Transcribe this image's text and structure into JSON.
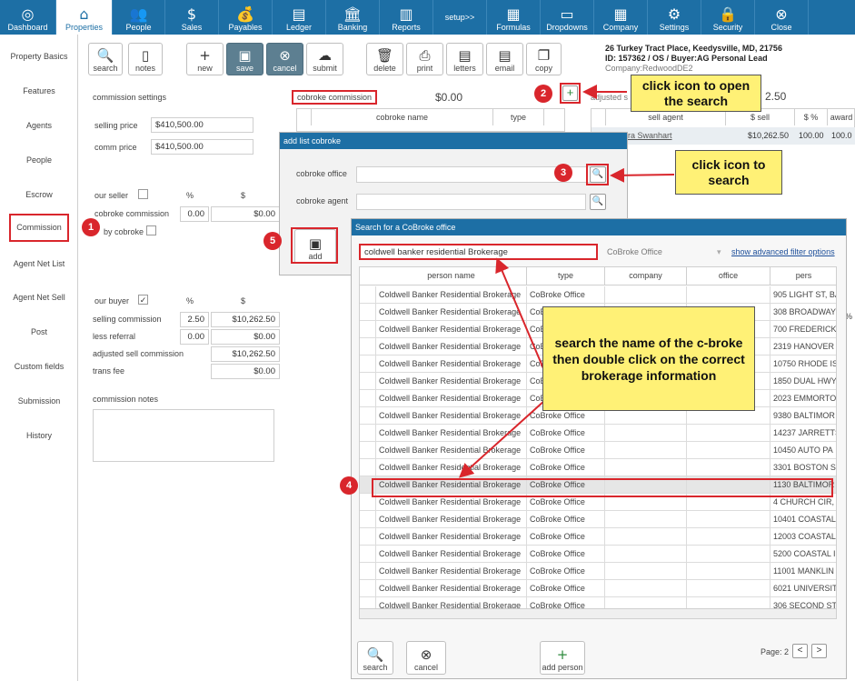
{
  "nav": {
    "items": [
      {
        "key": "dashboard",
        "label": "Dashboard",
        "icon": "◎"
      },
      {
        "key": "properties",
        "label": "Properties",
        "icon": "⌂"
      },
      {
        "key": "people",
        "label": "People",
        "icon": "👥"
      },
      {
        "key": "sales",
        "label": "Sales",
        "icon": "$"
      },
      {
        "key": "payables",
        "label": "Payables",
        "icon": "💰"
      },
      {
        "key": "ledger",
        "label": "Ledger",
        "icon": "▤"
      },
      {
        "key": "banking",
        "label": "Banking",
        "icon": "🏛"
      },
      {
        "key": "reports",
        "label": "Reports",
        "icon": "▥"
      },
      {
        "key": "setup",
        "label": "setup>>",
        "icon": ""
      },
      {
        "key": "formulas",
        "label": "Formulas",
        "icon": "▦"
      },
      {
        "key": "dropdowns",
        "label": "Dropdowns",
        "icon": "▭"
      },
      {
        "key": "company",
        "label": "Company",
        "icon": "▦"
      },
      {
        "key": "settings",
        "label": "Settings",
        "icon": "⚙"
      },
      {
        "key": "security",
        "label": "Security",
        "icon": "🔒"
      },
      {
        "key": "close",
        "label": "Close",
        "icon": "⊗"
      }
    ]
  },
  "sidebar": {
    "items": [
      "Property Basics",
      "Features",
      "Agents",
      "People",
      "Escrow",
      "Commission",
      "Agent Net List",
      "Agent Net Sell",
      "Post",
      "Custom fields",
      "Submission",
      "History"
    ]
  },
  "toolbar": {
    "search": "search",
    "notes": "notes",
    "new": "new",
    "save": "save",
    "cancel": "cancel",
    "submit": "submit",
    "delete": "delete",
    "print": "print",
    "letters": "letters",
    "email": "email",
    "copy": "copy"
  },
  "property": {
    "address": "26 Turkey Tract Place, Keedysville, MD, 21756",
    "id_line": "ID: 157362 / OS / Buyer:AG Personal Lead",
    "company": "Company:RedwoodDE2"
  },
  "commission": {
    "settings_label": "commission settings",
    "selling_price_label": "selling price",
    "selling_price": "$410,500.00",
    "comm_price_label": "comm price",
    "comm_price": "$410,500.00",
    "our_seller_label": "our seller",
    "percent_header": "%",
    "dollar_header": "$",
    "cobroke_commission_label": "cobroke commission",
    "cobroke_commission_pct": "0.00",
    "cobroke_commission_amt": "$0.00",
    "by_cobroke_label": "by cobroke",
    "our_buyer_label": "our buyer",
    "our_buyer_check": "✓",
    "selling_commission_label": "selling commission",
    "selling_commission_pct": "2.50",
    "selling_commission_amt": "$10,262.50",
    "less_referral_label": "less referral",
    "less_referral_pct": "0.00",
    "less_referral_amt": "$0.00",
    "adjusted_sell_label": "adjusted sell commission",
    "adjusted_sell_amt": "$10,262.50",
    "trans_fee_label": "trans fee",
    "trans_fee_amt": "$0.00",
    "notes_label": "commission notes"
  },
  "cobroke": {
    "label": "cobroke commission",
    "amount": "$0.00",
    "col_name": "cobroke name",
    "col_type": "type"
  },
  "sell_agent": {
    "adjusted_label": "adjusted s",
    "adjusted_value": "2.50",
    "col_agent": "sell agent",
    "col_sell": "$ sell",
    "col_pct": "$ %",
    "col_award": "award",
    "agent": "ra Swanhart",
    "sell": "$10,262.50",
    "pct": "100.00",
    "award": "100.0",
    "pct_symbol": "%"
  },
  "add_dialog": {
    "title": "add list cobroke",
    "office_label": "cobroke office",
    "agent_label": "cobroke agent",
    "add_label": "add"
  },
  "search_dialog": {
    "title": "Search for a CoBroke office",
    "query": "coldwell banker residential Brokerage",
    "filter": "CoBroke Office",
    "advanced": "show advanced filter options",
    "columns": [
      "person name",
      "type",
      "company",
      "office",
      "pers"
    ],
    "rows": [
      {
        "name": "Coldwell Banker Residential Brokerage",
        "type": "CoBroke Office",
        "person": "905 LIGHT ST, BA"
      },
      {
        "name": "Coldwell Banker Residential Brokerage",
        "type": "CoBroke Office",
        "person": "308 BROADWAY"
      },
      {
        "name": "Coldwell Banker Residential Brokerage",
        "type": "CoBroke Office",
        "person": "700 FREDERICK"
      },
      {
        "name": "Coldwell Banker Residential Brokerage",
        "type": "CoBroke Office",
        "person": "2319 HANOVER"
      },
      {
        "name": "Coldwell Banker Residential Brokerage",
        "type": "CoBroke Office",
        "person": "10750 RHODE IS"
      },
      {
        "name": "Coldwell Banker Residential Brokerage",
        "type": "CoBroke Office",
        "person": "1850 DUAL HWY"
      },
      {
        "name": "Coldwell Banker Residential Brokerage",
        "type": "CoBroke Office",
        "person": "2023 EMMORTO"
      },
      {
        "name": "Coldwell Banker Residential Brokerage",
        "type": "CoBroke Office",
        "person": "9380 BALTIMOR"
      },
      {
        "name": "Coldwell Banker Residential Brokerage",
        "type": "CoBroke Office",
        "person": "14237 JARRETTS"
      },
      {
        "name": "Coldwell Banker Residential Brokerage",
        "type": "CoBroke Office",
        "person": "10450 AUTO PA"
      },
      {
        "name": "Coldwell Banker Residential Brokerage",
        "type": "CoBroke Office",
        "person": "3301 BOSTON S"
      },
      {
        "name": "Coldwell Banker Residential Brokerage",
        "type": "CoBroke Office",
        "person": "1130 BALTIMOR"
      },
      {
        "name": "Coldwell Banker Residential Brokerage",
        "type": "CoBroke Office",
        "person": "4 CHURCH CIR, A"
      },
      {
        "name": "Coldwell Banker Residential Brokerage",
        "type": "CoBroke Office",
        "person": "10401 COASTAL"
      },
      {
        "name": "Coldwell Banker Residential Brokerage",
        "type": "CoBroke Office",
        "person": "12003 COASTAL"
      },
      {
        "name": "Coldwell Banker Residential Brokerage",
        "type": "CoBroke Office",
        "person": "5200 COASTAL I"
      },
      {
        "name": "Coldwell Banker Residential Brokerage",
        "type": "CoBroke Office",
        "person": "11001 MANKLIN"
      },
      {
        "name": "Coldwell Banker Residential Brokerage",
        "type": "CoBroke Office",
        "person": "6021 UNIVERSIT"
      },
      {
        "name": "Coldwell Banker Residential Brokerage",
        "type": "CoBroke Office",
        "person": "306 SECOND ST,"
      }
    ],
    "search_btn": "search",
    "cancel_btn": "cancel",
    "add_person_btn": "add person",
    "page_label": "Page: 2",
    "prev": "<",
    "next": ">"
  },
  "callouts": {
    "c1": "click icon to open the search",
    "c2": "click icon to search",
    "c3": "search the name of the c-broke then double click on the correct brokerage information"
  },
  "badges": [
    "1",
    "2",
    "3",
    "4",
    "5"
  ]
}
